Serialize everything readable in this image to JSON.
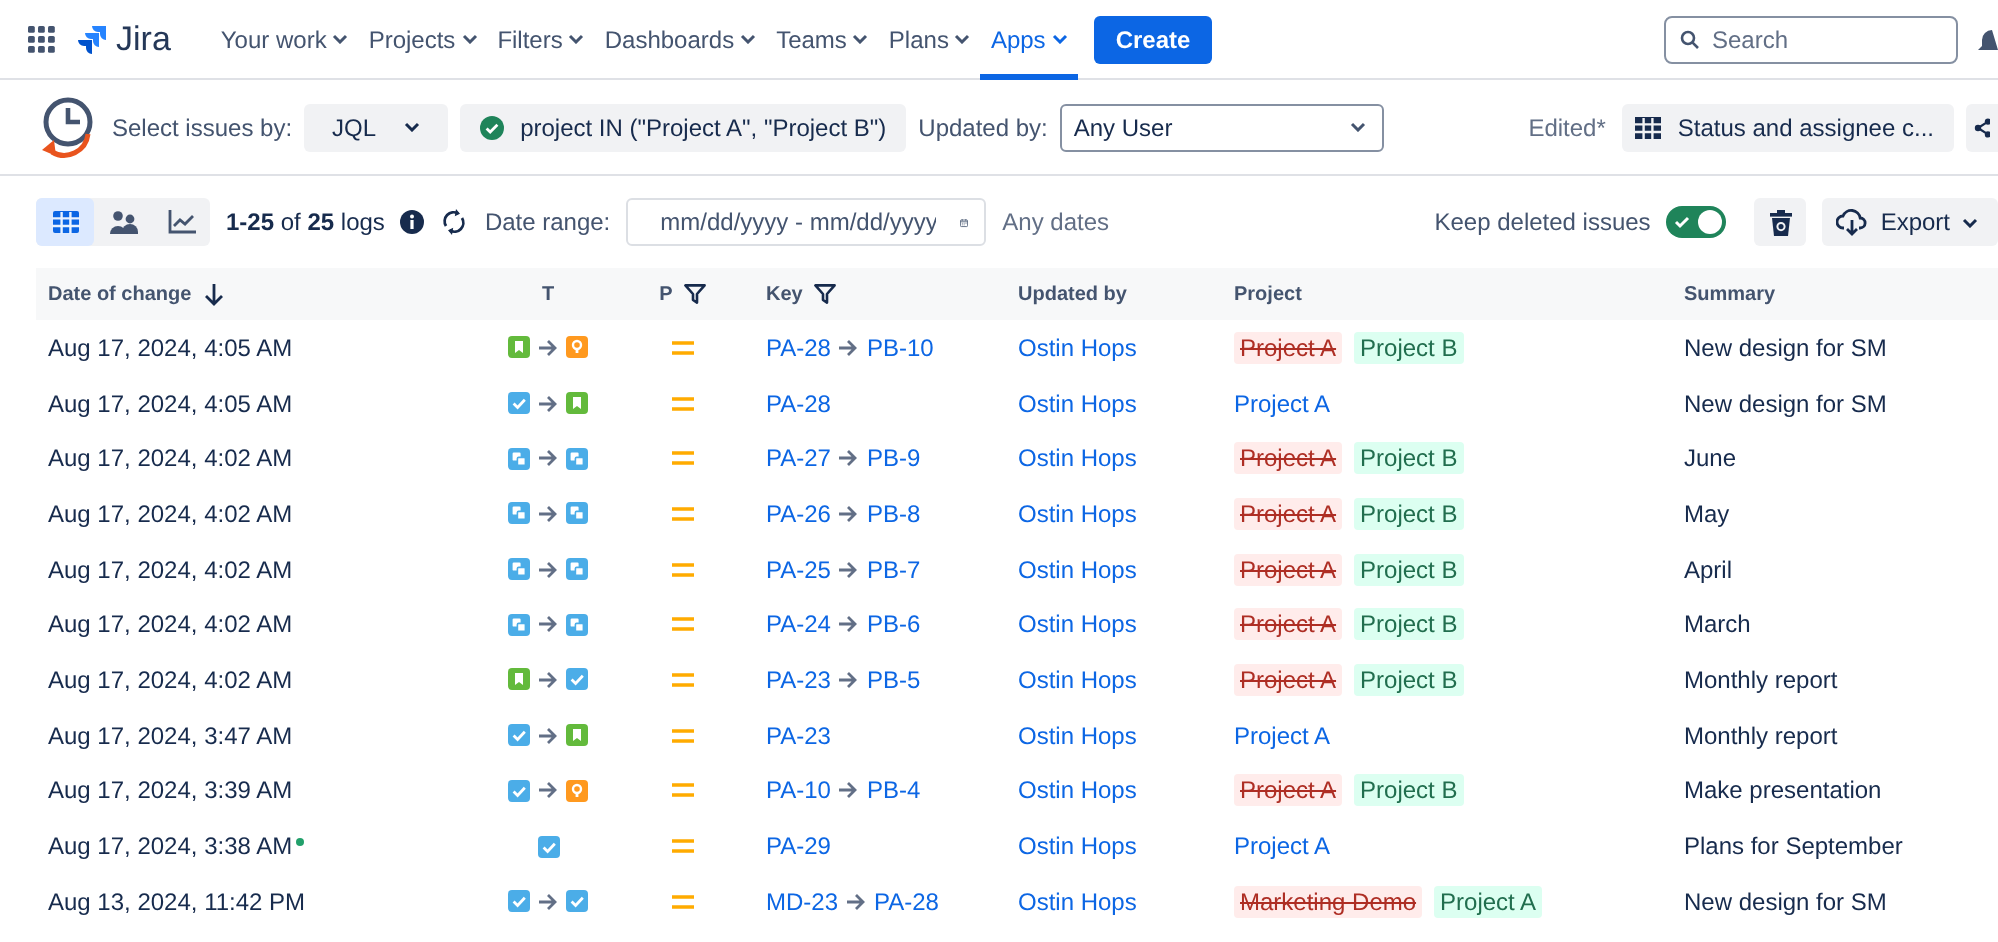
{
  "nav": {
    "product": "Jira",
    "items": [
      {
        "label": "Your work",
        "selected": false
      },
      {
        "label": "Projects",
        "selected": false
      },
      {
        "label": "Filters",
        "selected": false
      },
      {
        "label": "Dashboards",
        "selected": false
      },
      {
        "label": "Teams",
        "selected": false
      },
      {
        "label": "Plans",
        "selected": false
      },
      {
        "label": "Apps",
        "selected": true
      }
    ],
    "create": "Create",
    "search_placeholder": "Search"
  },
  "filters": {
    "select_label": "Select issues by:",
    "mode": "JQL",
    "query": "project IN (\"Project A\", \"Project B\")",
    "query_valid": true,
    "updated_label": "Updated by:",
    "user": "Any User",
    "edited": "Edited*",
    "view": "Status and assignee c..."
  },
  "toolbar": {
    "views": [
      {
        "kind": "table",
        "selected": true
      },
      {
        "kind": "people",
        "selected": false
      },
      {
        "kind": "chart",
        "selected": false
      }
    ],
    "count": "**1-25** of **25** logs",
    "date_label": "Date range:",
    "date_placeholder": "mm/dd/yyyy - mm/dd/yyyy",
    "date_hint": "Any dates",
    "keep_label": "Keep deleted issues",
    "keep_on": true,
    "export": "Export"
  },
  "columns": [
    {
      "label": "Date of change",
      "kind": "sort"
    },
    {
      "label": "T",
      "kind": "plain"
    },
    {
      "label": "P",
      "kind": "filter"
    },
    {
      "label": "Key",
      "kind": "filter"
    },
    {
      "label": "Updated by",
      "kind": "plain"
    },
    {
      "label": "Project",
      "kind": "plain"
    },
    {
      "label": "Summary",
      "kind": "plain"
    }
  ],
  "rows": [
    {
      "date": "Aug 17, 2024, 4:05 AM",
      "new": false,
      "types": [
        {
          "kind": "story"
        },
        {
          "kind": "idea"
        }
      ],
      "priority": {
        "kind": "medium"
      },
      "keys": [
        "PA-28",
        "PB-10"
      ],
      "user": "Ostin Hops",
      "projects": [
        {
          "name": "Project A",
          "removed": true
        },
        {
          "name": "Project B",
          "removed": false
        }
      ],
      "summary": "New design for SM"
    },
    {
      "date": "Aug 17, 2024, 4:05 AM",
      "new": false,
      "types": [
        {
          "kind": "task"
        },
        {
          "kind": "story"
        }
      ],
      "priority": {
        "kind": "medium"
      },
      "keys": [
        "PA-28"
      ],
      "user": "Ostin Hops",
      "projects": [
        {
          "name": "Project A",
          "removed": false
        }
      ],
      "summary": "New design for SM"
    },
    {
      "date": "Aug 17, 2024, 4:02 AM",
      "new": false,
      "types": [
        {
          "kind": "subtask"
        },
        {
          "kind": "subtask"
        }
      ],
      "priority": {
        "kind": "medium"
      },
      "keys": [
        "PA-27",
        "PB-9"
      ],
      "user": "Ostin Hops",
      "projects": [
        {
          "name": "Project A",
          "removed": true
        },
        {
          "name": "Project B",
          "removed": false
        }
      ],
      "summary": "June"
    },
    {
      "date": "Aug 17, 2024, 4:02 AM",
      "new": false,
      "types": [
        {
          "kind": "subtask"
        },
        {
          "kind": "subtask"
        }
      ],
      "priority": {
        "kind": "medium"
      },
      "keys": [
        "PA-26",
        "PB-8"
      ],
      "user": "Ostin Hops",
      "projects": [
        {
          "name": "Project A",
          "removed": true
        },
        {
          "name": "Project B",
          "removed": false
        }
      ],
      "summary": "May"
    },
    {
      "date": "Aug 17, 2024, 4:02 AM",
      "new": false,
      "types": [
        {
          "kind": "subtask"
        },
        {
          "kind": "subtask"
        }
      ],
      "priority": {
        "kind": "medium"
      },
      "keys": [
        "PA-25",
        "PB-7"
      ],
      "user": "Ostin Hops",
      "projects": [
        {
          "name": "Project A",
          "removed": true
        },
        {
          "name": "Project B",
          "removed": false
        }
      ],
      "summary": "April"
    },
    {
      "date": "Aug 17, 2024, 4:02 AM",
      "new": false,
      "types": [
        {
          "kind": "subtask"
        },
        {
          "kind": "subtask"
        }
      ],
      "priority": {
        "kind": "medium"
      },
      "keys": [
        "PA-24",
        "PB-6"
      ],
      "user": "Ostin Hops",
      "projects": [
        {
          "name": "Project A",
          "removed": true
        },
        {
          "name": "Project B",
          "removed": false
        }
      ],
      "summary": "March"
    },
    {
      "date": "Aug 17, 2024, 4:02 AM",
      "new": false,
      "types": [
        {
          "kind": "story"
        },
        {
          "kind": "task"
        }
      ],
      "priority": {
        "kind": "medium"
      },
      "keys": [
        "PA-23",
        "PB-5"
      ],
      "user": "Ostin Hops",
      "projects": [
        {
          "name": "Project A",
          "removed": true
        },
        {
          "name": "Project B",
          "removed": false
        }
      ],
      "summary": "Monthly report"
    },
    {
      "date": "Aug 17, 2024, 3:47 AM",
      "new": false,
      "types": [
        {
          "kind": "task"
        },
        {
          "kind": "story"
        }
      ],
      "priority": {
        "kind": "medium"
      },
      "keys": [
        "PA-23"
      ],
      "user": "Ostin Hops",
      "projects": [
        {
          "name": "Project A",
          "removed": false
        }
      ],
      "summary": "Monthly report"
    },
    {
      "date": "Aug 17, 2024, 3:39 AM",
      "new": false,
      "types": [
        {
          "kind": "task"
        },
        {
          "kind": "idea"
        }
      ],
      "priority": {
        "kind": "medium"
      },
      "keys": [
        "PA-10",
        "PB-4"
      ],
      "user": "Ostin Hops",
      "projects": [
        {
          "name": "Project A",
          "removed": true
        },
        {
          "name": "Project B",
          "removed": false
        }
      ],
      "summary": "Make presentation"
    },
    {
      "date": "Aug 17, 2024, 3:38 AM",
      "new": true,
      "types": [
        {
          "kind": "task"
        }
      ],
      "priority": {
        "kind": "medium"
      },
      "keys": [
        "PA-29"
      ],
      "user": "Ostin Hops",
      "projects": [
        {
          "name": "Project A",
          "removed": false
        }
      ],
      "summary": "Plans for September"
    },
    {
      "date": "Aug 13, 2024, 11:42 PM",
      "new": false,
      "types": [
        {
          "kind": "task"
        },
        {
          "kind": "task"
        }
      ],
      "priority": {
        "kind": "medium"
      },
      "keys": [
        "MD-23",
        "PA-28"
      ],
      "user": "Ostin Hops",
      "projects": [
        {
          "name": "Marketing Demo",
          "removed": true
        },
        {
          "name": "Project A",
          "removed": false
        }
      ],
      "summary": "New design for SM"
    }
  ]
}
